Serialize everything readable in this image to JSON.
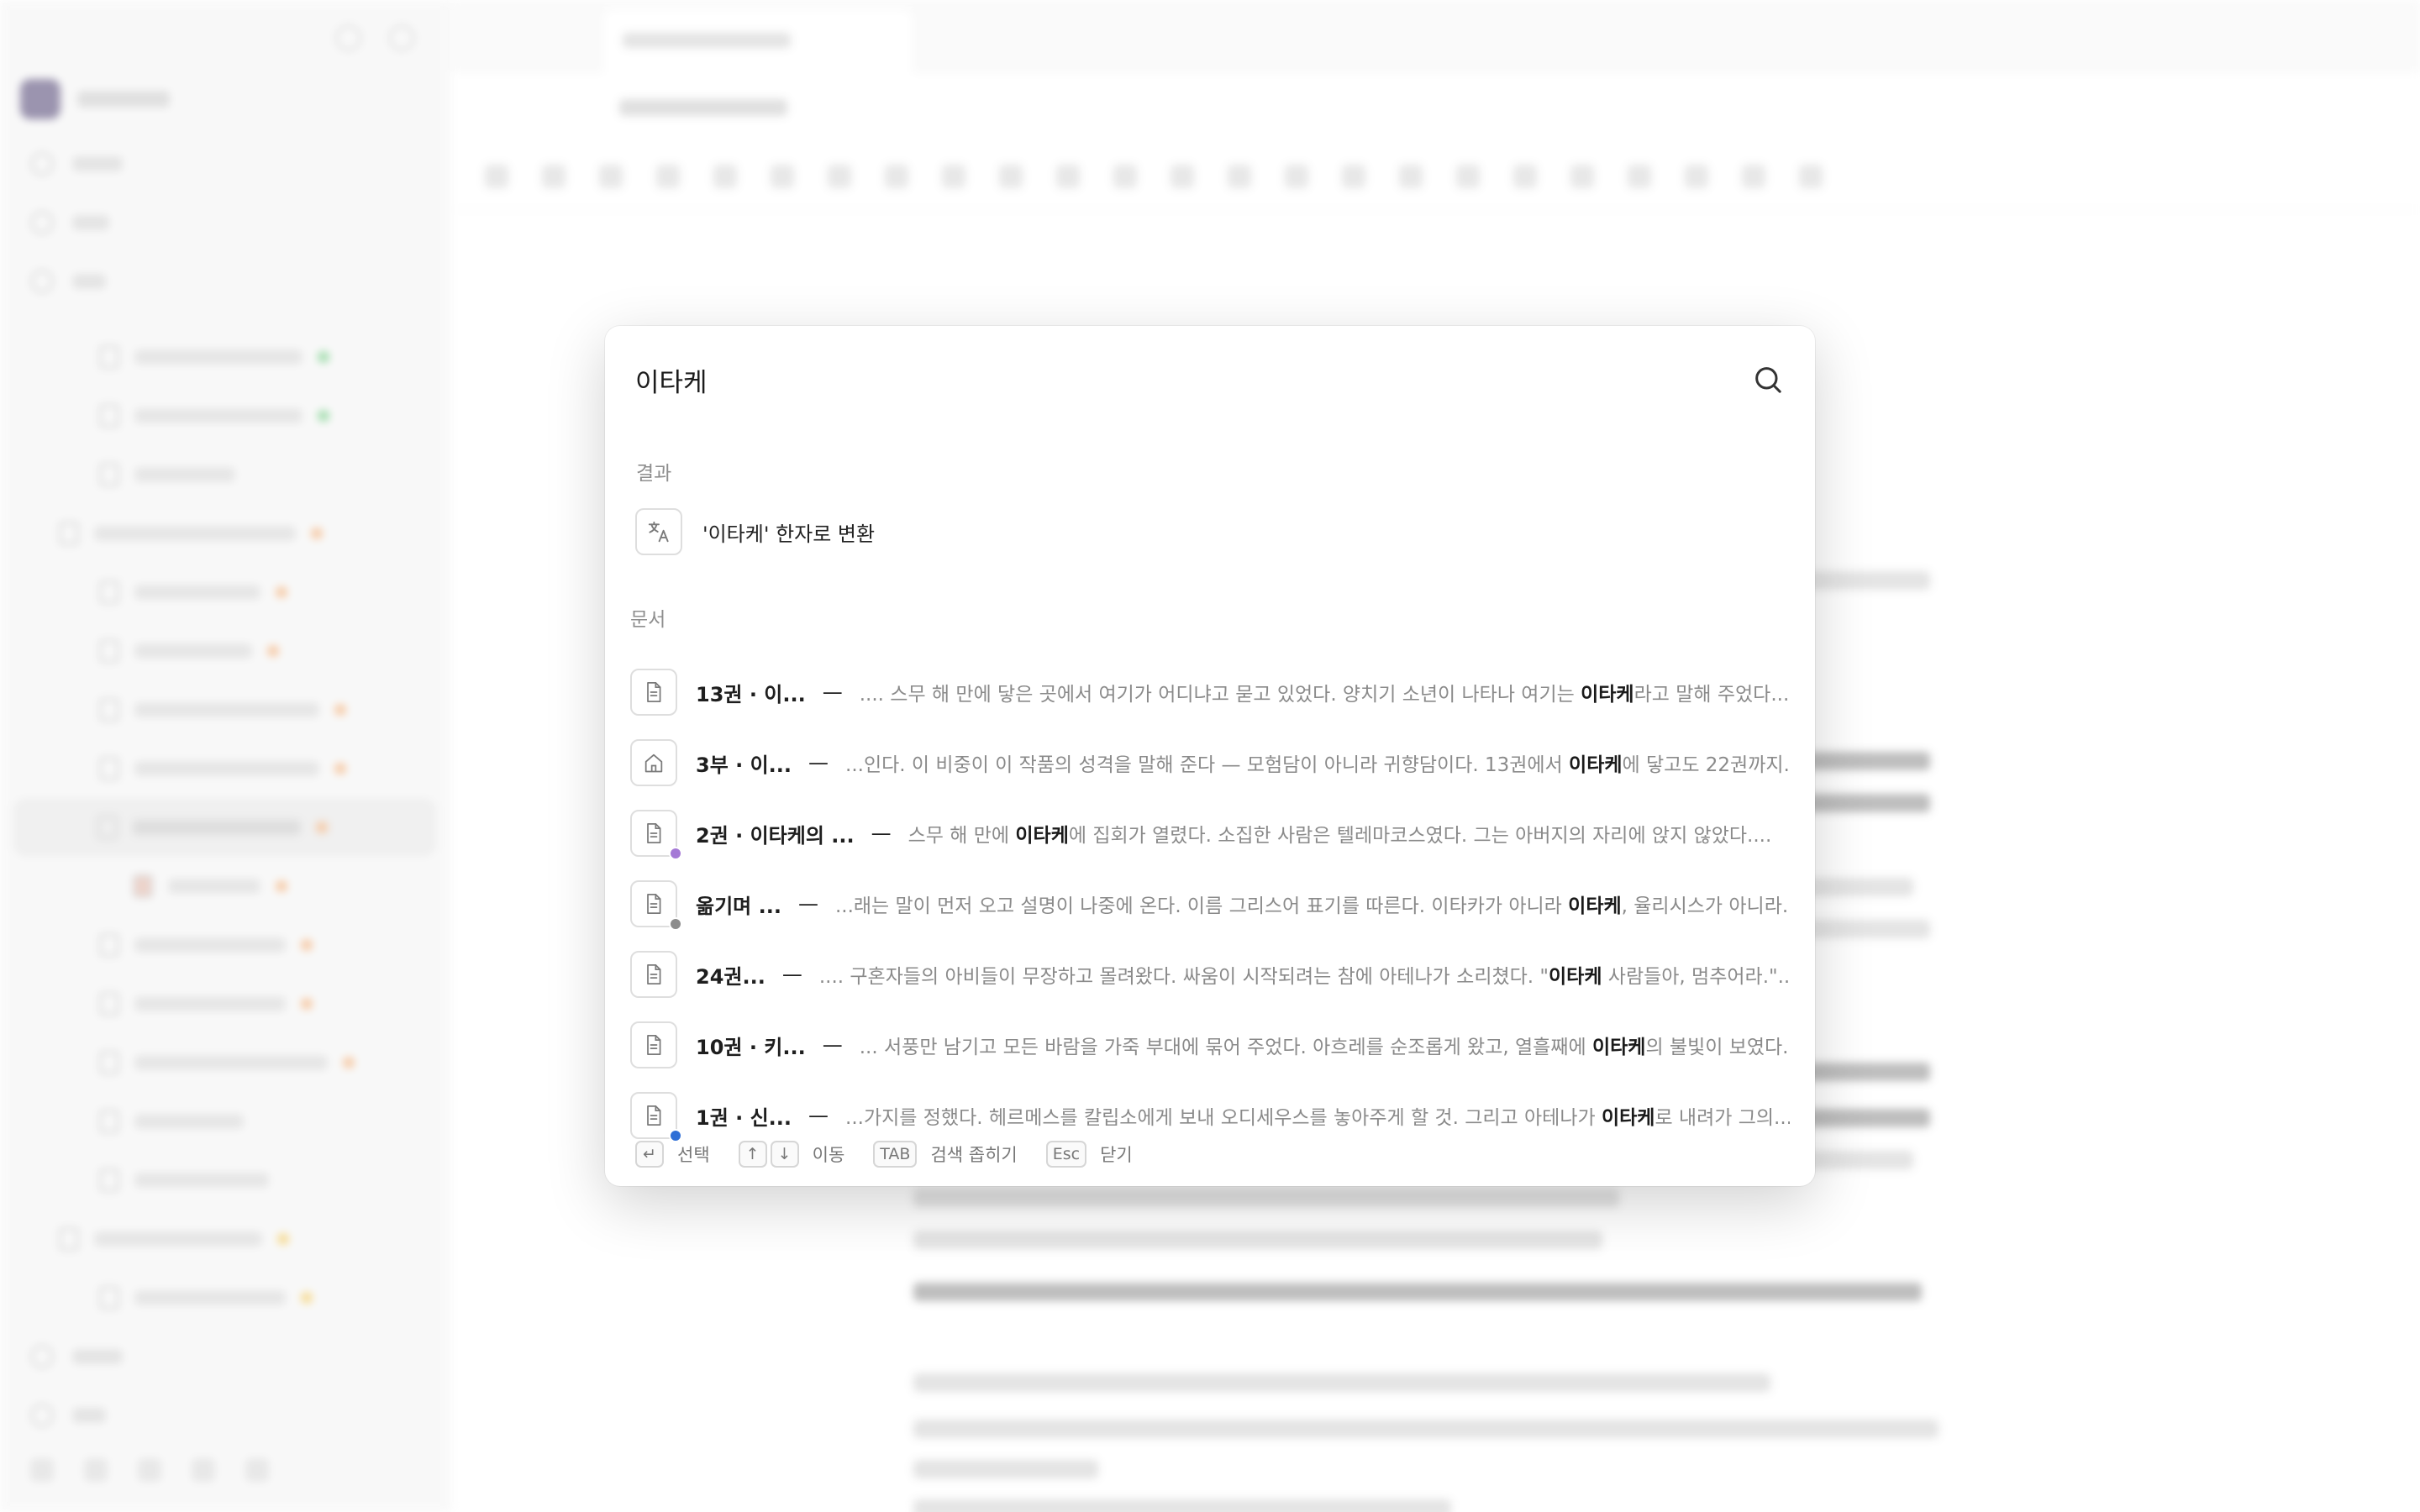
{
  "search": {
    "query": "이타케",
    "placeholder": ""
  },
  "sections": {
    "results_label": "결과",
    "documents_label": "문서"
  },
  "convert": {
    "label": "'이타케' 한자로 변환",
    "icon": "translate-icon"
  },
  "documents": [
    {
      "icon": "document-icon",
      "dot_color": null,
      "title": "13권 · 이...",
      "dash": "—",
      "before": ".... 스무 해 만에 닿은 곳에서 여기가 어디냐고 묻고 있었다. 양치기 소년이 나타나 여기는 ",
      "match": "이타케",
      "after": "라고 말해 주었다...."
    },
    {
      "icon": "home-icon",
      "dot_color": null,
      "title": "3부 · 이...",
      "dash": "—",
      "before": "...인다. 이 비중이 이 작품의 성격을 말해 준다 — 모험담이 아니라 귀향담이다. 13권에서 ",
      "match": "이타케",
      "after": "에 닿고도 22권까지..."
    },
    {
      "icon": "document-icon",
      "dot_color": "#a579d6",
      "title": "2권 · 이타케의 ...",
      "dash": "—",
      "before": "스무 해 만에 ",
      "match": "이타케",
      "after": "에 집회가 열렸다. 소집한 사람은 텔레마코스였다. 그는 아버지의 자리에 앉지 않았다...."
    },
    {
      "icon": "document-icon",
      "dot_color": "#8c8c8c",
      "title": "옮기며 ...",
      "dash": "—",
      "before": "...래는 말이 먼저 오고 설명이 나중에 온다. 이름 그리스어 표기를 따른다. 이타카가 아니라 ",
      "match": "이타케",
      "after": ", 율리시스가 아니라..."
    },
    {
      "icon": "document-icon",
      "dot_color": null,
      "title": "24권...",
      "dash": "—",
      "before": ".... 구혼자들의 아비들이 무장하고 몰려왔다. 싸움이 시작되려는 참에 아테나가 소리쳤다. \"",
      "match": "이타케",
      "after": " 사람들아, 멈추어라.\"..."
    },
    {
      "icon": "document-icon",
      "dot_color": null,
      "title": "10권 · 키...",
      "dash": "—",
      "before": "... 서풍만 남기고 모든 바람을 가죽 부대에 묶어 주었다. 아흐레를 순조롭게 왔고, 열흘째에 ",
      "match": "이타케",
      "after": "의 불빛이 보였다...."
    },
    {
      "icon": "document-icon",
      "dot_color": "#2f6fd6",
      "title": "1권 · 신...",
      "dash": "—",
      "before": "...가지를 정했다. 헤르메스를 칼립소에게 보내 오디세우스를 놓아주게 할 것. 그리고 아테나가 ",
      "match": "이타케",
      "after": "로 내려가 그의..."
    }
  ],
  "hints": [
    {
      "keys": [
        "↵"
      ],
      "label": "선택"
    },
    {
      "keys": [
        "↑",
        "↓"
      ],
      "label": "이동"
    },
    {
      "keys": [
        "TAB"
      ],
      "label": "검색 좁히기"
    },
    {
      "keys": [
        "Esc"
      ],
      "label": "닫기"
    }
  ]
}
